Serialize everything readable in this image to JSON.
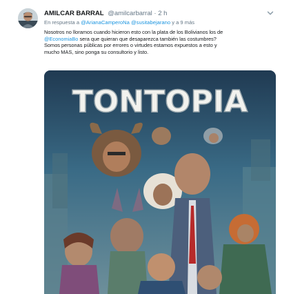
{
  "tweet": {
    "author_name": "AMILCAR BARRAL",
    "author_handle": "@amilcarbarral",
    "separator": "·",
    "time": "2 h",
    "reply_prefix": "En respuesta a",
    "reply_mentions": [
      "@ArianaCamperoNa",
      "@susitabejarano"
    ],
    "reply_suffix": "y a 9 más",
    "body_lines": [
      "Nosotros no lloramos cuando hicieron esto con la plata de los Bolivianos los de",
      "sera que quieran que desaparezca también las costumbres?",
      "Somos personas públicas por errores o virtudes estamos expuestos a esto y",
      "mucho MAS, sino ponga su consultorio y listo."
    ],
    "body_mention": "@EconomiaBo",
    "media": {
      "poster_title": "TONTOPIA",
      "alt_icon": "image-icon"
    },
    "icons": {
      "menu": "chevron-down-icon",
      "avatar": "avatar-photo"
    }
  },
  "colors": {
    "text": "#14171a",
    "muted": "#657786",
    "link": "#1b95e0",
    "poster_sky": "#27445c",
    "poster_title": "#f2f2ee"
  }
}
